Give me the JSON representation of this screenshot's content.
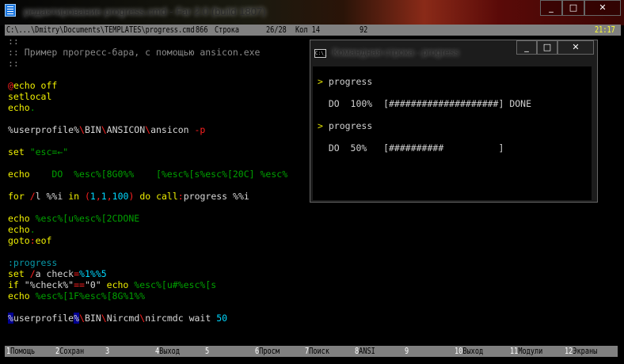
{
  "window": {
    "title": "редактирование progress.cmd - Far 2.0 (build 1807)",
    "minimize": "_",
    "maximize": "□",
    "close": "✕"
  },
  "status": {
    "path": "C:\\...\\Dmitry\\Documents\\TEMPLATES\\progress.cmd",
    "code": "866",
    "line_label": "Строка",
    "line_pos": "26/28",
    "col": "Кол 14",
    "char": "92",
    "clock": "21:17"
  },
  "editor": {
    "lines": [
      [
        [
          "::",
          "gray"
        ]
      ],
      [
        [
          ":: Пример прогресс-бара, с помощью ansicon.exe",
          "gray"
        ]
      ],
      [
        [
          "::",
          "gray"
        ]
      ],
      [],
      [
        [
          "@",
          "red"
        ],
        [
          "echo off",
          "yel"
        ]
      ],
      [
        [
          "setlocal",
          "yel"
        ]
      ],
      [
        [
          "echo",
          "yel"
        ],
        [
          ".",
          "grn"
        ]
      ],
      [],
      [
        [
          "%userprofile%",
          "wht"
        ],
        [
          "\\",
          "red"
        ],
        [
          "BIN",
          "wht"
        ],
        [
          "\\",
          "red"
        ],
        [
          "ANSICON",
          "wht"
        ],
        [
          "\\",
          "red"
        ],
        [
          "ansicon ",
          "wht"
        ],
        [
          "-p",
          "red"
        ]
      ],
      [],
      [
        [
          "set ",
          "yel"
        ],
        [
          "\"esc=←\"",
          "grn"
        ]
      ],
      [],
      [
        [
          "echo",
          "yel"
        ],
        [
          "    DO  %esc%[8G0%%    [%esc%[s%esc%[20C] %esc%",
          "grn"
        ]
      ],
      [],
      [
        [
          "for ",
          "yel"
        ],
        [
          "/",
          "red"
        ],
        [
          "l ",
          "wht"
        ],
        [
          "%%i ",
          "wht"
        ],
        [
          "in ",
          "yel"
        ],
        [
          "(",
          "red"
        ],
        [
          "1",
          "cyan"
        ],
        [
          ",",
          "red"
        ],
        [
          "1",
          "cyan"
        ],
        [
          ",",
          "red"
        ],
        [
          "100",
          "cyan"
        ],
        [
          ")",
          "red"
        ],
        [
          " do call",
          "yel"
        ],
        [
          ":",
          "red"
        ],
        [
          "progress %%i",
          "wht"
        ]
      ],
      [],
      [
        [
          "echo ",
          "yel"
        ],
        [
          "%esc%[u%esc%[2CDONE",
          "grn"
        ]
      ],
      [
        [
          "echo",
          "yel"
        ],
        [
          ".",
          "grn"
        ]
      ],
      [
        [
          "goto",
          "yel"
        ],
        [
          ":",
          "red"
        ],
        [
          "eof",
          "yel"
        ]
      ],
      [],
      [
        [
          ":progress",
          "teal"
        ]
      ],
      [
        [
          "set ",
          "yel"
        ],
        [
          "/",
          "red"
        ],
        [
          "a check",
          "wht"
        ],
        [
          "=",
          "red"
        ],
        [
          "%1%%5",
          "cyan"
        ]
      ],
      [
        [
          "if ",
          "yel"
        ],
        [
          "\"%check%\"",
          "wht"
        ],
        [
          "==",
          "red"
        ],
        [
          "\"0\"",
          "wht"
        ],
        [
          " echo ",
          "yel"
        ],
        [
          "%esc%[u#%esc%[s",
          "grn"
        ]
      ],
      [
        [
          "echo ",
          "yel"
        ],
        [
          "%esc%[1F%esc%[8G%1%%",
          "grn"
        ]
      ],
      [],
      [
        [
          "%",
          "sel"
        ],
        [
          "userprofile",
          "wht"
        ],
        [
          "%",
          "sel"
        ],
        [
          "\\",
          "red"
        ],
        [
          "BIN",
          "wht"
        ],
        [
          "\\",
          "red"
        ],
        [
          "Nircmd",
          "wht"
        ],
        [
          "\\",
          "red"
        ],
        [
          "nircmdc wait ",
          "wht"
        ],
        [
          "50",
          "cyan"
        ]
      ]
    ]
  },
  "keybar": [
    {
      "n": "1",
      "l": "Помощь"
    },
    {
      "n": "2",
      "l": "Сохран"
    },
    {
      "n": "3",
      "l": ""
    },
    {
      "n": "4",
      "l": "Выход"
    },
    {
      "n": "5",
      "l": ""
    },
    {
      "n": "6",
      "l": "Просм"
    },
    {
      "n": "7",
      "l": "Поиск"
    },
    {
      "n": "8",
      "l": "ANSI"
    },
    {
      "n": "9",
      "l": ""
    },
    {
      "n": "10",
      "l": "Выход"
    },
    {
      "n": "11",
      "l": "Модули"
    },
    {
      "n": "12",
      "l": "Экраны"
    }
  ],
  "console": {
    "title": "Командная строка - progress",
    "icon_text": "C:\\_",
    "prompt": ">",
    "rows": [
      {
        "prompt": true,
        "text": "progress"
      },
      {
        "prompt": false,
        "text": "  DO  100%  [####################] DONE"
      },
      {
        "prompt": true,
        "text": "progress"
      },
      {
        "prompt": false,
        "text": "  DO  50%   [##########          ]"
      }
    ]
  }
}
